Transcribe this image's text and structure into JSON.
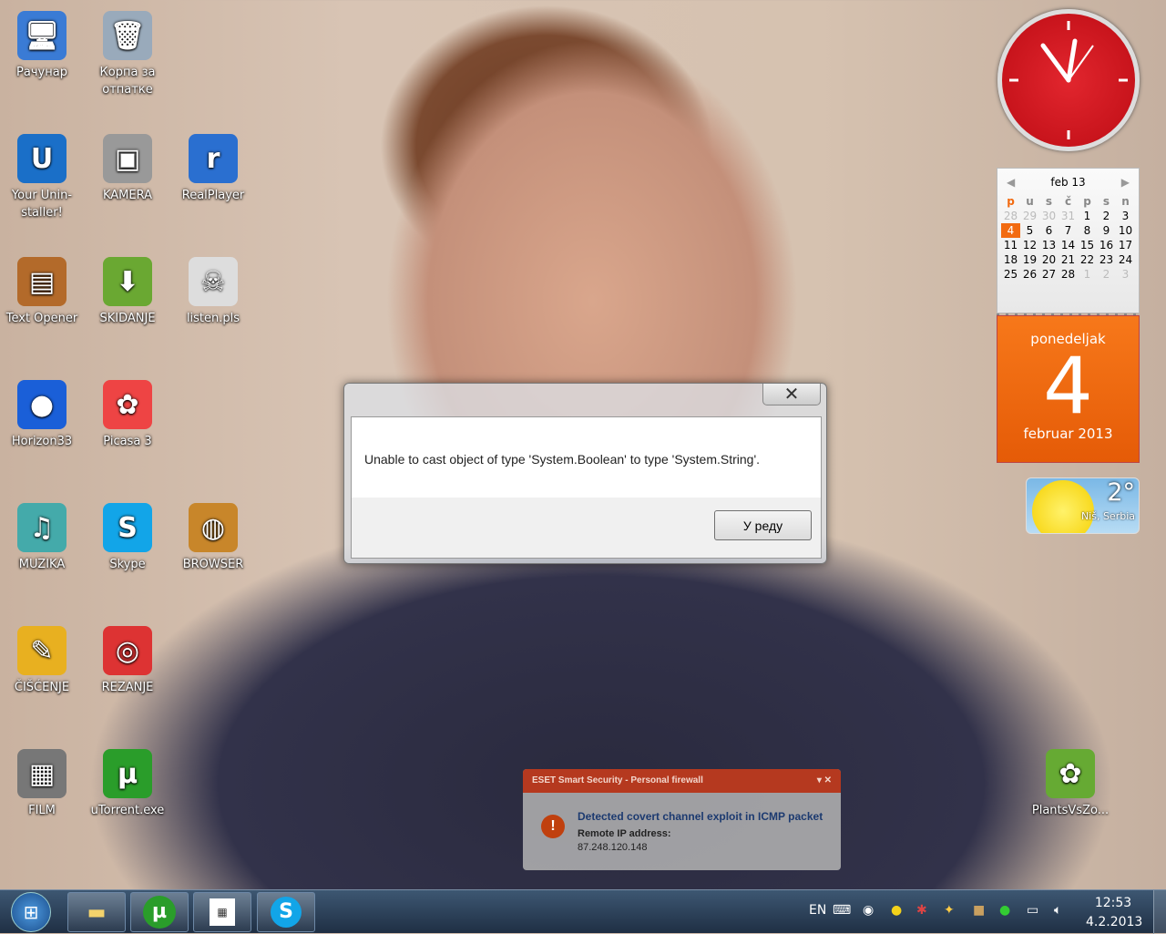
{
  "desktop_icons": [
    {
      "label": "Рачунар",
      "icon": "computer-icon"
    },
    {
      "label": "Корпа за отпатке",
      "icon": "recycle-bin-icon"
    },
    {
      "label": "Your Unin-staller!",
      "icon": "uninstaller-icon"
    },
    {
      "label": "KAMERA",
      "icon": "camera-icon"
    },
    {
      "label": "RealPlayer",
      "icon": "realplayer-icon"
    },
    {
      "label": "Text Opener",
      "icon": "book-icon"
    },
    {
      "label": "SKIDANJE",
      "icon": "download-folder-icon"
    },
    {
      "label": "listen.pls",
      "icon": "playlist-file-icon"
    },
    {
      "label": "Horizon33",
      "icon": "globe-icon"
    },
    {
      "label": "Picasa 3",
      "icon": "picasa-icon"
    },
    {
      "label": "MUZIKA",
      "icon": "music-icon"
    },
    {
      "label": "Skype",
      "icon": "skype-icon"
    },
    {
      "label": "BROWSER",
      "icon": "browser-globe-icon"
    },
    {
      "label": "ČIŠĆENJE",
      "icon": "broom-icon"
    },
    {
      "label": "REZANJE",
      "icon": "burn-disc-icon"
    },
    {
      "label": "FILM",
      "icon": "film-icon"
    },
    {
      "label": "uTorrent.exe",
      "icon": "utorrent-icon"
    },
    {
      "label": "PlantsVsZo...",
      "icon": "plants-icon"
    }
  ],
  "calendar": {
    "month_label": "feb 13",
    "weekdays": [
      "p",
      "u",
      "s",
      "č",
      "p",
      "s",
      "n"
    ],
    "weeks": [
      [
        "28",
        "29",
        "30",
        "31",
        "1",
        "2",
        "3"
      ],
      [
        "4",
        "5",
        "6",
        "7",
        "8",
        "9",
        "10"
      ],
      [
        "11",
        "12",
        "13",
        "14",
        "15",
        "16",
        "17"
      ],
      [
        "18",
        "19",
        "20",
        "21",
        "22",
        "23",
        "24"
      ],
      [
        "25",
        "26",
        "27",
        "28",
        "1",
        "2",
        "3"
      ]
    ],
    "day_name": "ponedeljak",
    "day": "4",
    "month_year": "februar 2013"
  },
  "weather": {
    "temp": "2°",
    "location": "Niš, Serbia"
  },
  "dialog": {
    "message": "Unable to cast object of type 'System.Boolean' to type 'System.String'.",
    "ok_label": "У реду",
    "close": "✕"
  },
  "eset": {
    "title": "ESET Smart Security - Personal firewall",
    "headline": "Detected covert channel exploit in ICMP packet",
    "ip_label": "Remote IP address:",
    "ip": "87.248.120.148"
  },
  "taskbar": {
    "language": "EN",
    "time": "12:53",
    "date": "4.2.2013"
  }
}
